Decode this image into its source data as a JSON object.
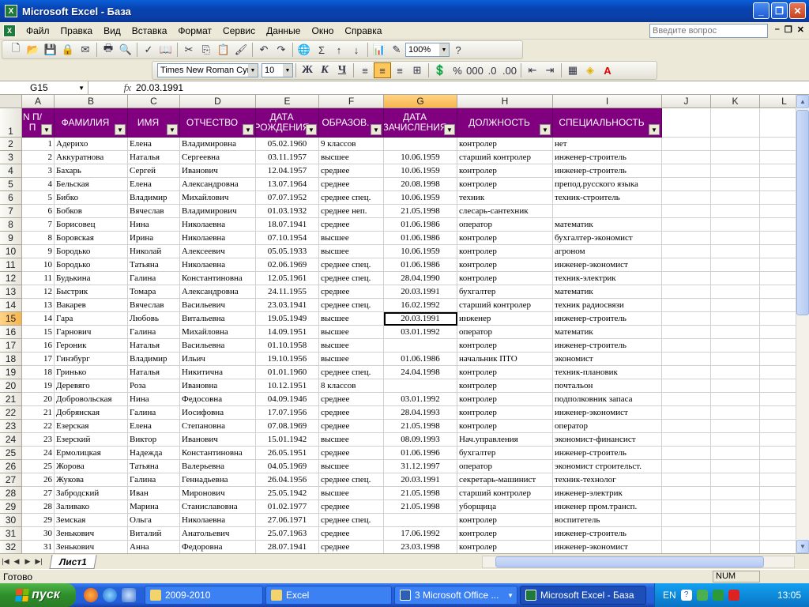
{
  "window": {
    "title": "Microsoft Excel - База"
  },
  "menu": [
    "Файл",
    "Правка",
    "Вид",
    "Вставка",
    "Формат",
    "Сервис",
    "Данные",
    "Окно",
    "Справка"
  ],
  "question_placeholder": "Введите вопрос",
  "toolbar": {
    "zoom": "100%",
    "font": "Times New Roman Cyr",
    "font_size": "10"
  },
  "formula_bar": {
    "cell_ref": "G15",
    "fx": "fx",
    "value": "20.03.1991"
  },
  "columns": [
    "A",
    "B",
    "C",
    "D",
    "E",
    "F",
    "G",
    "H",
    "I",
    "J",
    "K",
    "L"
  ],
  "headers": [
    "N П/П",
    "ФАМИЛИЯ",
    "ИМЯ",
    "ОТЧЕСТВО",
    "ДАТА РОЖДЕНИЯ",
    "ОБРАЗОВ.",
    "ДАТА ЗАЧИСЛЕНИЯ",
    "ДОЛЖНОСТЬ",
    "СПЕЦИАЛЬНОСТЬ"
  ],
  "rows": [
    [
      "1",
      "Адерихо",
      "Елена",
      "Владимировна",
      "05.02.1960",
      "9 классов",
      "",
      "контролер",
      "нет"
    ],
    [
      "2",
      "Аккуратнова",
      "Наталья",
      "Сергеевна",
      "03.11.1957",
      "высшее",
      "10.06.1959",
      "старший контролер",
      "инженер-строитель"
    ],
    [
      "3",
      "Бахарь",
      "Сергей",
      "Иванович",
      "12.04.1957",
      "среднее",
      "10.06.1959",
      "контролер",
      "инженер-строитель"
    ],
    [
      "4",
      "Бельская",
      "Елена",
      "Александровна",
      "13.07.1964",
      "среднее",
      "20.08.1998",
      "контролер",
      "препод.русского языка"
    ],
    [
      "5",
      "Бибко",
      "Владимир",
      "Михайлович",
      "07.07.1952",
      "среднее спец.",
      "10.06.1959",
      "техник",
      "техник-строитель"
    ],
    [
      "6",
      "Бобков",
      "Вячеслав",
      "Владимирович",
      "01.03.1932",
      "среднее неп.",
      "21.05.1998",
      "слесарь-сантехник",
      ""
    ],
    [
      "7",
      "Борисовец",
      "Нина",
      "Николаевна",
      "18.07.1941",
      "среднее",
      "01.06.1986",
      "оператор",
      "математик"
    ],
    [
      "8",
      "Боровская",
      "Ирина",
      "Николаевна",
      "07.10.1954",
      "высшее",
      "01.06.1986",
      "контролер",
      "бухгалтер-экономист"
    ],
    [
      "9",
      "Бородько",
      "Николай",
      "Алексеевич",
      "05.05.1933",
      "высшее",
      "10.06.1959",
      "контролер",
      "агроном"
    ],
    [
      "10",
      "Бородько",
      "Татьяна",
      "Николаевна",
      "02.06.1969",
      "среднее спец.",
      "01.06.1986",
      "контролер",
      "инженер-экономист"
    ],
    [
      "11",
      "Будькина",
      "Галина",
      "Константиновна",
      "12.05.1961",
      "среднее спец.",
      "28.04.1990",
      "контролер",
      "техник-электрик"
    ],
    [
      "12",
      "Быстрик",
      "Томара",
      "Александровна",
      "24.11.1955",
      "среднее",
      "20.03.1991",
      "бухгалтер",
      "математик"
    ],
    [
      "13",
      "Вакарев",
      "Вячеслав",
      "Васильевич",
      "23.03.1941",
      "среднее спец.",
      "16.02.1992",
      "старший контролер",
      "техник радиосвязи"
    ],
    [
      "14",
      "Гара",
      "Любовь",
      "Витальевна",
      "19.05.1949",
      "высшее",
      "20.03.1991",
      "инженер",
      "инженер-строитель"
    ],
    [
      "15",
      "Гарнович",
      "Галина",
      "Михайловна",
      "14.09.1951",
      "высшее",
      "03.01.1992",
      "оператор",
      "математик"
    ],
    [
      "16",
      "Героник",
      "Наталья",
      "Васильевна",
      "01.10.1958",
      "высшее",
      "",
      "контролер",
      "инженер-строитель"
    ],
    [
      "17",
      "Гинзбург",
      "Владимир",
      "Ильич",
      "19.10.1956",
      "высшее",
      "01.06.1986",
      "начальник ПТО",
      "экономист"
    ],
    [
      "18",
      "Гринько",
      "Наталья",
      "Никитична",
      "01.01.1960",
      "среднее спец.",
      "24.04.1998",
      "контролер",
      "техник-плановик"
    ],
    [
      "19",
      "Деревяго",
      "Роза",
      "Ивановна",
      "10.12.1951",
      "8 классов",
      "",
      "контролер",
      "почтальон"
    ],
    [
      "20",
      "Добровольская",
      "Нина",
      "Федосовна",
      "04.09.1946",
      "среднее",
      "03.01.1992",
      "контролер",
      "подполковник запаса"
    ],
    [
      "21",
      "Добрянская",
      "Галина",
      "Иосифовна",
      "17.07.1956",
      "среднее",
      "28.04.1993",
      "контролер",
      "инженер-экономист"
    ],
    [
      "22",
      "Езерская",
      "Елена",
      "Степановна",
      "07.08.1969",
      "среднее",
      "21.05.1998",
      "контролер",
      "оператор"
    ],
    [
      "23",
      "Езерский",
      "Виктор",
      "Иванович",
      "15.01.1942",
      "высшее",
      "08.09.1993",
      "Нач.управления",
      "экономист-финансист"
    ],
    [
      "24",
      "Ермолицкая",
      "Надежда",
      "Константиновна",
      "26.05.1951",
      "среднее",
      "01.06.1996",
      "бухгалтер",
      "инженер-строитель"
    ],
    [
      "25",
      "Жорова",
      "Татьяна",
      "Валерьевна",
      "04.05.1969",
      "высшее",
      "31.12.1997",
      "оператор",
      "экономист строительст."
    ],
    [
      "26",
      "Жукова",
      "Галина",
      "Геннадьевна",
      "26.04.1956",
      "среднее спец.",
      "20.03.1991",
      "секретарь-машинист",
      "техник-технолог"
    ],
    [
      "27",
      "Забродский",
      "Иван",
      "Миронович",
      "25.05.1942",
      "высшее",
      "21.05.1998",
      "старший контролер",
      "инженер-электрик"
    ],
    [
      "28",
      "Заливако",
      "Марина",
      "Станиславовна",
      "01.02.1977",
      "среднее",
      "21.05.1998",
      "уборщица",
      "инженер пром.трансп."
    ],
    [
      "29",
      "Земская",
      "Ольга",
      "Николаевна",
      "27.06.1971",
      "среднее спец.",
      "",
      "контролер",
      "воспитетель"
    ],
    [
      "30",
      "Зенькович",
      "Виталий",
      "Анатольевич",
      "25.07.1963",
      "среднее",
      "17.06.1992",
      "контролер",
      "инженер-строитель"
    ],
    [
      "31",
      "Зенькович",
      "Анна",
      "Федоровна",
      "28.07.1941",
      "среднее",
      "23.03.1998",
      "контролер",
      "инженер-экономист"
    ]
  ],
  "sheet_tab": "Лист1",
  "status": {
    "ready": "Готово",
    "num": "NUM"
  },
  "taskbar": {
    "start": "пуск",
    "tasks": [
      "2009-2010",
      "Excel",
      "3 Microsoft Office ...",
      "Microsoft Excel - База"
    ],
    "lang": "EN",
    "clock": "13:05"
  },
  "colors": {
    "header_bg": "#800080",
    "selection": "#f7b54c"
  }
}
